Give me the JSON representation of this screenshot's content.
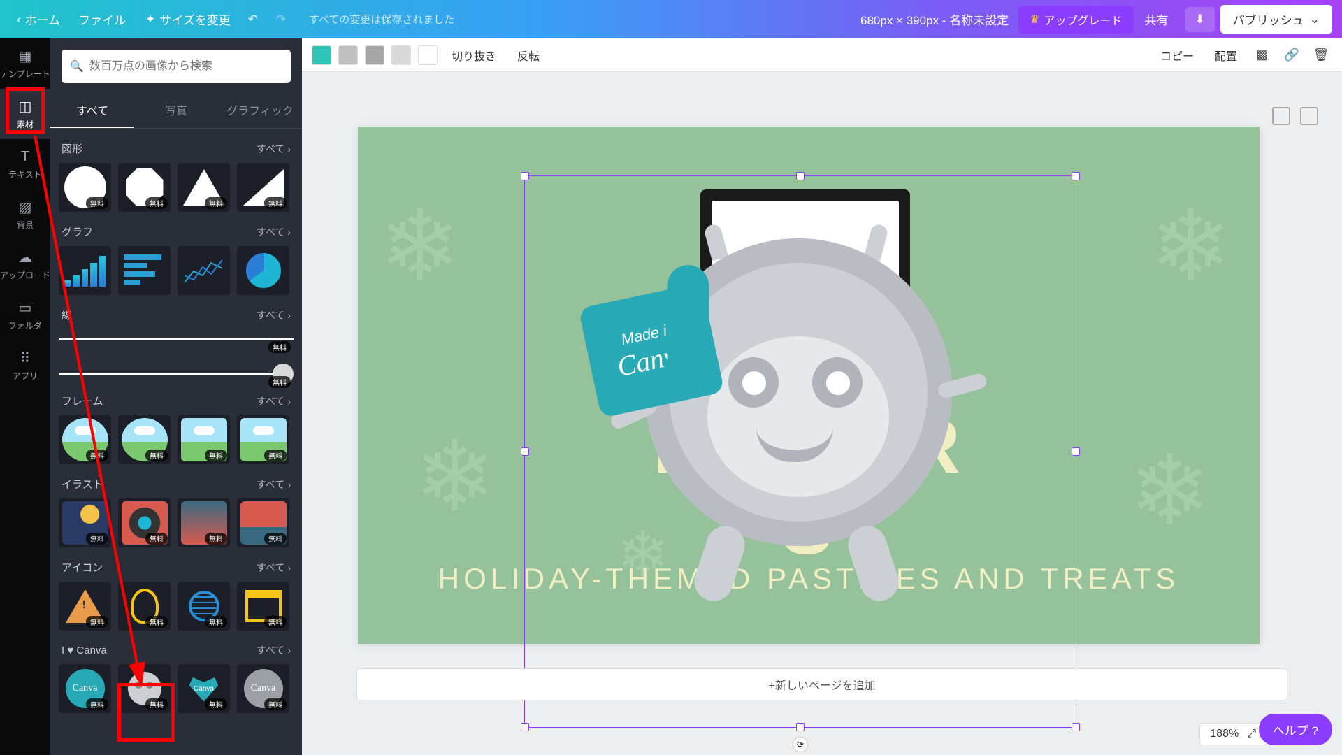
{
  "topbar": {
    "home": "ホーム",
    "file": "ファイル",
    "resize": "サイズを変更",
    "status": "すべての変更は保存されました",
    "dimensions": "680px × 390px - 名称未設定",
    "upgrade": "アップグレード",
    "share": "共有",
    "publish": "パブリッシュ"
  },
  "rail": {
    "templates": "テンプレート",
    "elements": "素材",
    "text": "テキスト",
    "background": "背景",
    "upload": "アップロード",
    "folder": "フォルダ",
    "apps": "アプリ"
  },
  "panel": {
    "search_placeholder": "数百万点の画像から検索",
    "tab_all": "すべて",
    "tab_photo": "写真",
    "tab_graphic": "グラフィック",
    "see_all": "すべて",
    "sec_shapes": "図形",
    "sec_charts": "グラフ",
    "sec_lines": "線",
    "sec_frames": "フレーム",
    "sec_illust": "イラスト",
    "sec_icons": "アイコン",
    "sec_canva": "I ♥ Canva",
    "free_badge": "無料"
  },
  "toolbar": {
    "crop": "切り抜き",
    "flip": "反転",
    "copy": "コピー",
    "arrange": "配置",
    "swatches": [
      "#2fc6b8",
      "#bfbfbf",
      "#a6a6a6",
      "#d9d9d9",
      "#ffffff"
    ]
  },
  "canvas": {
    "title_line1": "DEE                    ER",
    "title_line2": "S",
    "subtitle": "HOLIDAY-THEMED PASTRIES AND TREATS",
    "made_in_1": "Made in",
    "made_in_2": "Canva"
  },
  "footer": {
    "add_page": "+新しいページを追加",
    "zoom": "188%",
    "help": "ヘルプ ?"
  }
}
